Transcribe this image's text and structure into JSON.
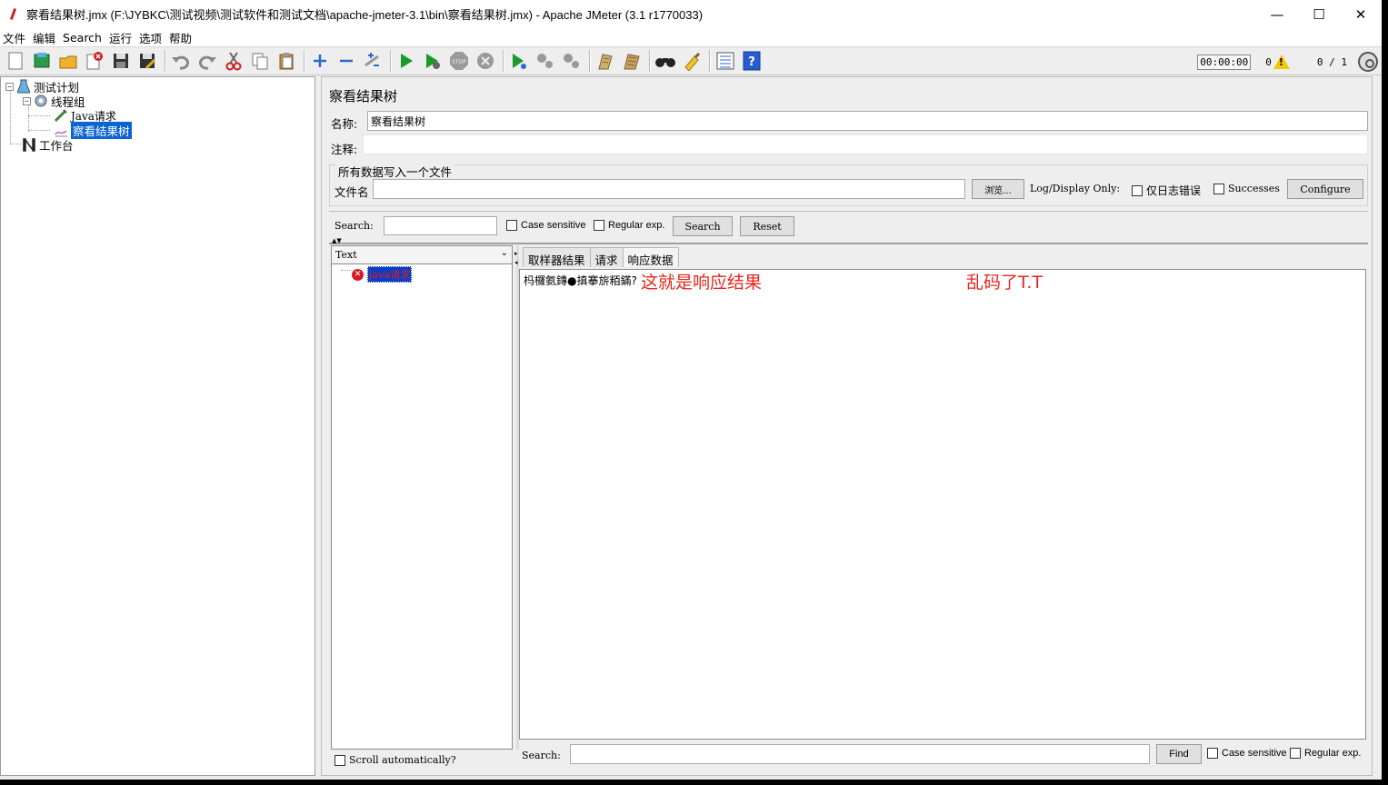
{
  "window": {
    "title": "察看结果树.jmx (F:\\JYBKC\\测试视频\\测试软件和测试文档\\apache-jmeter-3.1\\bin\\察看结果树.jmx) - Apache JMeter (3.1 r1770033)",
    "minimize": "—",
    "maximize": "☐",
    "close": "✕"
  },
  "menu": [
    "文件",
    "编辑",
    "Search",
    "运行",
    "选项",
    "帮助"
  ],
  "toolbar": {
    "timer": "00:00:00",
    "warnings": "0",
    "threads": "0 / 1",
    "icons": [
      "new-icon",
      "templates-icon",
      "open-icon",
      "close-icon",
      "save-icon",
      "save-as-icon",
      "undo-icon",
      "redo-icon",
      "cut-icon",
      "copy-icon",
      "paste-icon",
      "expand-icon",
      "collapse-icon",
      "toggle-icon",
      "start-icon",
      "start-no-pause-icon",
      "stop-icon",
      "shutdown-icon",
      "remote-start-icon",
      "remote-stop-icon",
      "remote-shutdown-icon",
      "clear-icon",
      "clear-all-icon",
      "search-icon",
      "reset-search-icon",
      "function-helper-icon",
      "help-icon"
    ]
  },
  "tree": {
    "test_plan": "测试计划",
    "thread_group": "线程组",
    "java_request": "Java请求",
    "view_results_tree": "察看结果树",
    "workbench": "工作台"
  },
  "panel": {
    "title": "察看结果树",
    "name_label": "名称:",
    "name_value": "察看结果树",
    "comment_label": "注释:",
    "comment_value": "",
    "file_group_title": "所有数据写入一个文件",
    "filename_label": "文件名",
    "filename_value": "",
    "browse": "浏览...",
    "log_display_only": "Log/Display Only:",
    "errors_only": "仅日志错误",
    "successes": "Successes",
    "configure": "Configure"
  },
  "search_bar": {
    "label": "Search:",
    "value": "",
    "case_sensitive": "Case sensitive",
    "regular_exp": "Regular exp.",
    "search": "Search",
    "reset": "Reset"
  },
  "results": {
    "renderer": "Text",
    "items": [
      {
        "label": "Java请求",
        "status": "error"
      }
    ],
    "scroll_auto": "Scroll automatically?"
  },
  "tabs": [
    "取样器结果",
    "请求",
    "响应数据"
  ],
  "response": {
    "garbled_text": "杩欏氨鏄●搷搴旂粨鏋?",
    "annotation_1": "这就是响应结果",
    "annotation_2": "乱码了T.T"
  },
  "bottom_search": {
    "label": "Search:",
    "value": "",
    "find": "Find",
    "case_sensitive": "Case sensitive",
    "regular_exp": "Regular exp."
  }
}
